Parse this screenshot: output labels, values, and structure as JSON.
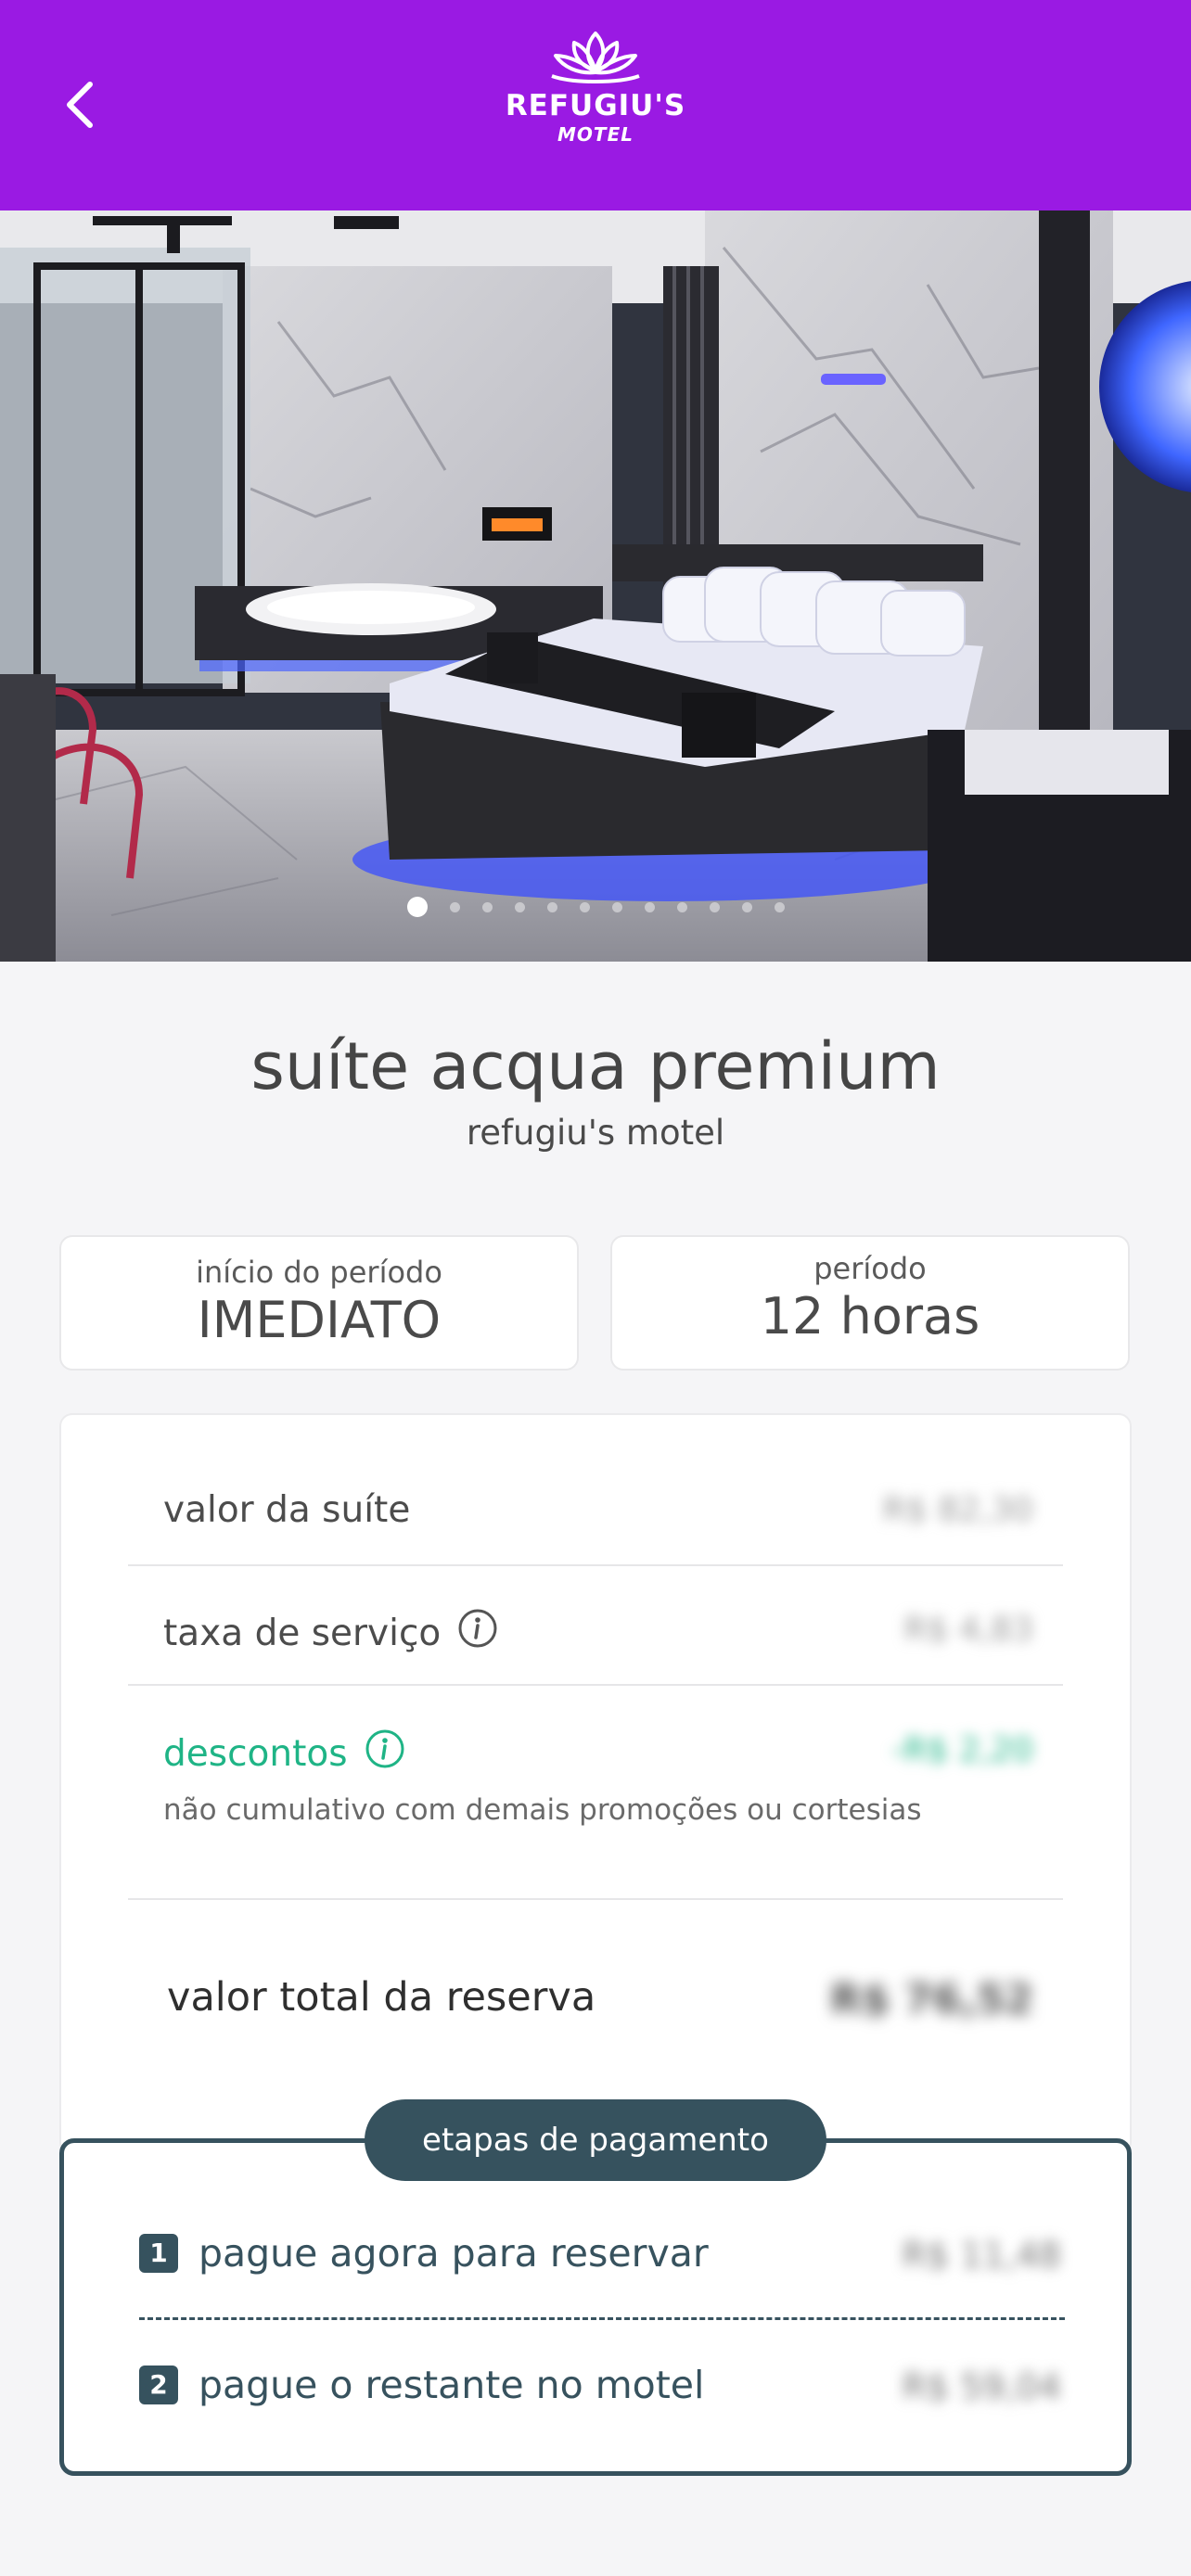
{
  "brand": {
    "name": "REFUGIU'S",
    "subtitle": "MOTEL",
    "header_color": "#9a1ae3"
  },
  "gallery": {
    "total_images": 12,
    "active_index": 0
  },
  "suite": {
    "name": "suíte acqua premium",
    "motel": "refugiu's motel"
  },
  "period": {
    "start_label": "início do período",
    "start_value": "IMEDIATO",
    "length_label": "período",
    "length_value": "12 horas"
  },
  "pricing": {
    "suite_label": "valor da suíte",
    "suite_value": "R$ 82,30",
    "service_label": "taxa de serviço",
    "service_value": "R$ 4,83",
    "discount_label": "descontos",
    "discount_value": "-R$ 2,20",
    "discount_note": "não cumulativo com demais promoções ou cortesias",
    "total_label": "valor total da reserva",
    "total_value": "R$ 76,52"
  },
  "payment_steps": {
    "title": "etapas de pagamento",
    "steps": [
      {
        "number": "1",
        "label": "pague agora para reservar",
        "value": "R$ 11,48"
      },
      {
        "number": "2",
        "label": "pague o restante no motel",
        "value": "R$ 59,04"
      }
    ]
  },
  "colors": {
    "accent_purple": "#9a1ae3",
    "discount_green": "#1fb486",
    "steps_dark": "#36525e"
  }
}
